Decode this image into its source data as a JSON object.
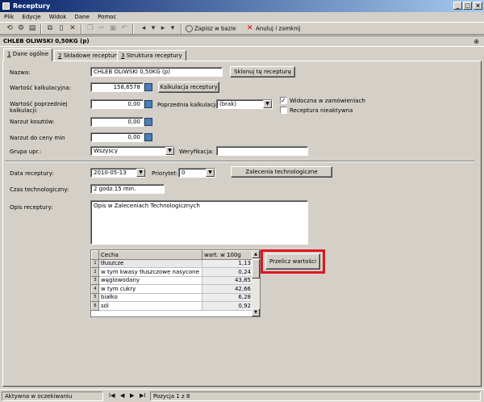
{
  "window": {
    "title": "Receptury",
    "min": "_",
    "max": "□",
    "close": "×"
  },
  "menu": [
    "Plik",
    "Edycje",
    "Widok",
    "Dane",
    "Pomoc"
  ],
  "toolbar": {
    "save_label": "Zapisz w bazie",
    "cancel_label": "Anuluj i zamknij"
  },
  "record_title": "CHLEB OLIWSKI 0,50KG (p)",
  "tabs": [
    {
      "key": "1",
      "label": " Dane ogólne"
    },
    {
      "key": "2",
      "label": " Składowe receptury"
    },
    {
      "key": "3",
      "label": " Struktura receptury"
    }
  ],
  "form": {
    "nazwa_label": "Nazwa:",
    "nazwa_value": "CHLEB OLIWSKI 0,50KG (p)",
    "clone_button": "Sklonuj tę recepturę",
    "wartosc_kalk_label": "Wartość kalkulacyjna:",
    "wartosc_kalk_value": "158,6578",
    "kalk_button": "Kalkulacja receptury",
    "wartosc_poprz_label_1": "Wartość poprzedniej",
    "wartosc_poprz_label_2": "kalkulacji:",
    "wartosc_poprz_value": "0,00",
    "poprz_kalk_label": "Poprzednia kalkulacja:",
    "poprz_kalk_value": "(brak)",
    "widoczna_label": "Widoczna w zamówieniach",
    "widoczna_checked": "✓",
    "nieaktywna_label": "Receptura nieaktywna",
    "narzut_label": "Narzut kosztów:",
    "narzut_value": "0,00",
    "narzut_min_label": "Narzut do ceny min",
    "narzut_min_value": "0,00",
    "grupa_label": "Grupa upr.:",
    "grupa_value": "Wszyscy",
    "weryfikacja_label": "Weryfikacja:",
    "weryfikacja_value": "",
    "data_label": "Data receptury:",
    "data_value": "2010-05-13",
    "priorytet_label": "Priorytet:",
    "priorytet_value": "0",
    "zalecenia_button": "Zalecenia technologiczne",
    "czas_label": "Czas technologiczny:",
    "czas_value": "2 godz.15 min.",
    "opis_label": "Opis receptury:",
    "opis_value": "Opis w Zaleceniach Technologicznych",
    "przelicz_button": "Przelicz wartości"
  },
  "grid": {
    "headers": [
      "Cecha",
      "wart. w 100g"
    ],
    "rows": [
      {
        "n": "1",
        "name": "tłuszcze",
        "val": "1,13"
      },
      {
        "n": "2",
        "name": "w tym kwasy tłuszczowe nasycone",
        "val": "0,24"
      },
      {
        "n": "3",
        "name": "węglowodany",
        "val": "43,85"
      },
      {
        "n": "4",
        "name": "w tym cukry",
        "val": "42,66"
      },
      {
        "n": "5",
        "name": "białko",
        "val": "6,28"
      },
      {
        "n": "6",
        "name": "sól",
        "val": "0,92"
      }
    ]
  },
  "status": {
    "state": "Aktywna w oczekiwaniu",
    "position": "Pozycja 1 z 8",
    "nav": [
      "I◀",
      "◀",
      "▶",
      "▶I"
    ]
  }
}
